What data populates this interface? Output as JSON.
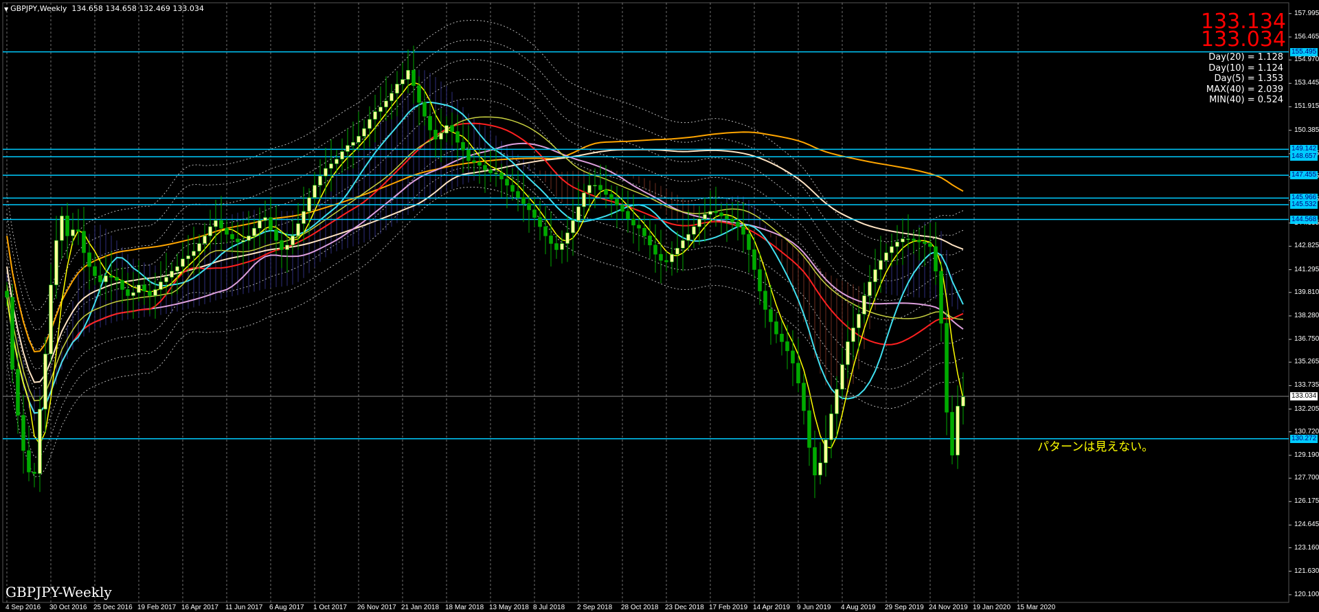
{
  "chart_window": {
    "symbol_title": "GBPJPY,Weekly",
    "ohlc": "134.658 134.658 132.469 133.034",
    "watermark": "GBPJPY-Weekly",
    "bid": "133.134",
    "ask": "133.034",
    "stats": [
      "Day(20) = 1.128",
      "Day(10) = 1.124",
      "Day(5) = 1.353",
      "MAX(40) = 2.039",
      "MIN(40) = 0.524"
    ],
    "annotation": "パターンは見えない。",
    "colors": {
      "background": "#000000",
      "bull": "#ffff99",
      "bear": "#00aa00",
      "level": "#00ccff",
      "price_label": "#ff0000"
    }
  },
  "price_axis": {
    "ticks": [
      "157.995",
      "156.465",
      "154.970",
      "153.445",
      "151.915",
      "150.385",
      "148.855",
      "147.355",
      "145.825",
      "144.335",
      "142.825",
      "141.295",
      "139.810",
      "138.280",
      "136.750",
      "135.265",
      "133.735",
      "132.205",
      "130.720",
      "129.190",
      "127.700",
      "126.175",
      "124.645",
      "123.160",
      "121.630",
      "120.100"
    ],
    "levels": [
      "155.495",
      "149.142",
      "148.657",
      "147.455",
      "145.966",
      "145.532",
      "144.568",
      "133.034",
      "130.272"
    ]
  },
  "time_axis": {
    "ticks": [
      "4 Sep 2016",
      "30 Oct 2016",
      "25 Dec 2016",
      "19 Feb 2017",
      "16 Apr 2017",
      "11 Jun 2017",
      "6 Aug 2017",
      "1 Oct 2017",
      "26 Nov 2017",
      "21 Jan 2018",
      "18 Mar 2018",
      "13 May 2018",
      "8 Jul 2018",
      "2 Sep 2018",
      "28 Oct 2018",
      "23 Dec 2018",
      "17 Feb 2019",
      "14 Apr 2019",
      "9 Jun 2019",
      "4 Aug 2019",
      "29 Sep 2019",
      "24 Nov 2019",
      "19 Jan 2020",
      "15 Mar 2020"
    ]
  },
  "chart_data": {
    "type": "line",
    "title": "GBPJPY,Weekly",
    "ylim": [
      119.6,
      158.7
    ],
    "grid": true,
    "x_labels_every": 8,
    "closes": [
      139.5,
      134.8,
      131.8,
      129.5,
      128.1,
      128.0,
      132.2,
      135.8,
      140.3,
      143.2,
      144.8,
      143.5,
      143.9,
      143.8,
      142.4,
      141.5,
      140.9,
      140.5,
      140.9,
      140.8,
      140.6,
      140.0,
      139.6,
      139.8,
      140.3,
      139.9,
      139.6,
      140.0,
      140.5,
      140.8,
      141.2,
      141.5,
      142.0,
      142.2,
      142.5,
      143.0,
      143.5,
      144.1,
      144.5,
      144.0,
      143.6,
      143.3,
      143.1,
      143.2,
      143.5,
      144.0,
      144.5,
      144.7,
      143.9,
      143.2,
      142.6,
      142.9,
      143.5,
      144.3,
      145.1,
      146.0,
      146.8,
      147.4,
      147.9,
      148.2,
      148.5,
      149.0,
      149.4,
      149.6,
      150.0,
      150.5,
      151.1,
      151.6,
      151.9,
      152.3,
      152.8,
      153.4,
      153.7,
      154.3,
      153.3,
      152.2,
      151.3,
      150.4,
      149.8,
      150.2,
      150.7,
      150.3,
      149.6,
      149.1,
      148.4,
      148.3,
      148.1,
      147.8,
      147.6,
      147.6,
      147.2,
      146.8,
      146.4,
      146.0,
      145.6,
      145.2,
      144.7,
      144.1,
      143.5,
      143.0,
      142.6,
      143.0,
      143.7,
      144.5,
      145.4,
      146.3,
      146.8,
      146.8,
      146.5,
      146.2,
      145.9,
      145.5,
      145.1,
      144.6,
      144.2,
      144.0,
      143.5,
      142.9,
      142.3,
      141.9,
      141.8,
      142.3,
      142.7,
      143.2,
      143.6,
      144.1,
      144.6,
      144.9,
      145.1,
      145.0,
      144.8,
      144.6,
      144.4,
      144.1,
      143.6,
      142.6,
      141.3,
      139.9,
      138.7,
      137.9,
      137.1,
      136.6,
      136.0,
      135.2,
      133.9,
      132.1,
      129.7,
      127.9,
      128.7,
      130.2,
      131.9,
      133.5,
      135.1,
      136.6,
      137.5,
      138.4,
      139.6,
      140.5,
      141.3,
      141.9,
      142.4,
      142.8,
      143.1,
      143.3,
      143.3,
      143.2,
      143.1,
      143.0,
      142.8,
      141.2,
      137.8,
      132.0,
      129.2,
      132.4,
      133.0
    ]
  }
}
